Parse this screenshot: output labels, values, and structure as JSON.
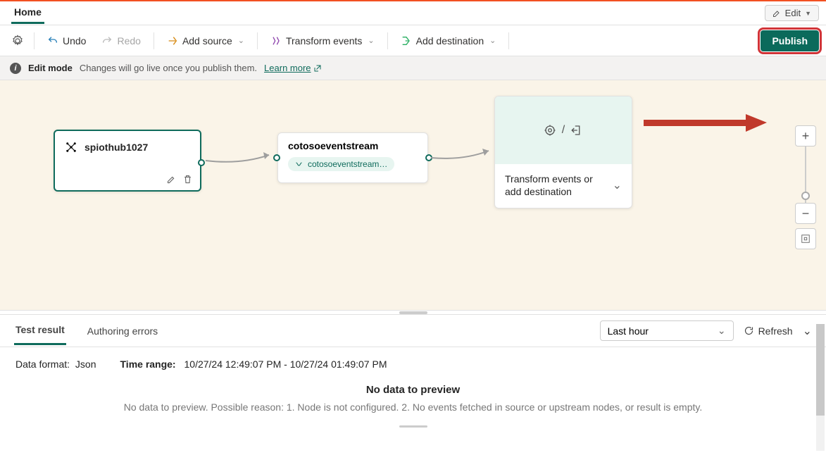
{
  "topTabs": {
    "home": "Home",
    "edit": "Edit"
  },
  "toolbar": {
    "undo": "Undo",
    "redo": "Redo",
    "addSource": "Add source",
    "transform": "Transform events",
    "addDest": "Add destination",
    "publish": "Publish"
  },
  "infobar": {
    "mode": "Edit mode",
    "msg": "Changes will go live once you publish them.",
    "link": "Learn more"
  },
  "nodes": {
    "source": {
      "name": "spiothub1027"
    },
    "stream": {
      "name": "cotosoeventstream",
      "pill": "cotosoeventstream…"
    },
    "dest": {
      "label": "Transform events or add destination"
    }
  },
  "bottom": {
    "tabs": {
      "testResult": "Test result",
      "authErrors": "Authoring errors"
    },
    "timeSelector": "Last hour",
    "refresh": "Refresh",
    "dataFormatLabel": "Data format:",
    "dataFormatValue": "Json",
    "timeRangeLabel": "Time range:",
    "timeRangeValue": "10/27/24 12:49:07 PM - 10/27/24 01:49:07 PM",
    "emptyTitle": "No data to preview",
    "emptyMsg": "No data to preview. Possible reason: 1. Node is not configured. 2. No events fetched in source or upstream nodes, or result is empty."
  }
}
